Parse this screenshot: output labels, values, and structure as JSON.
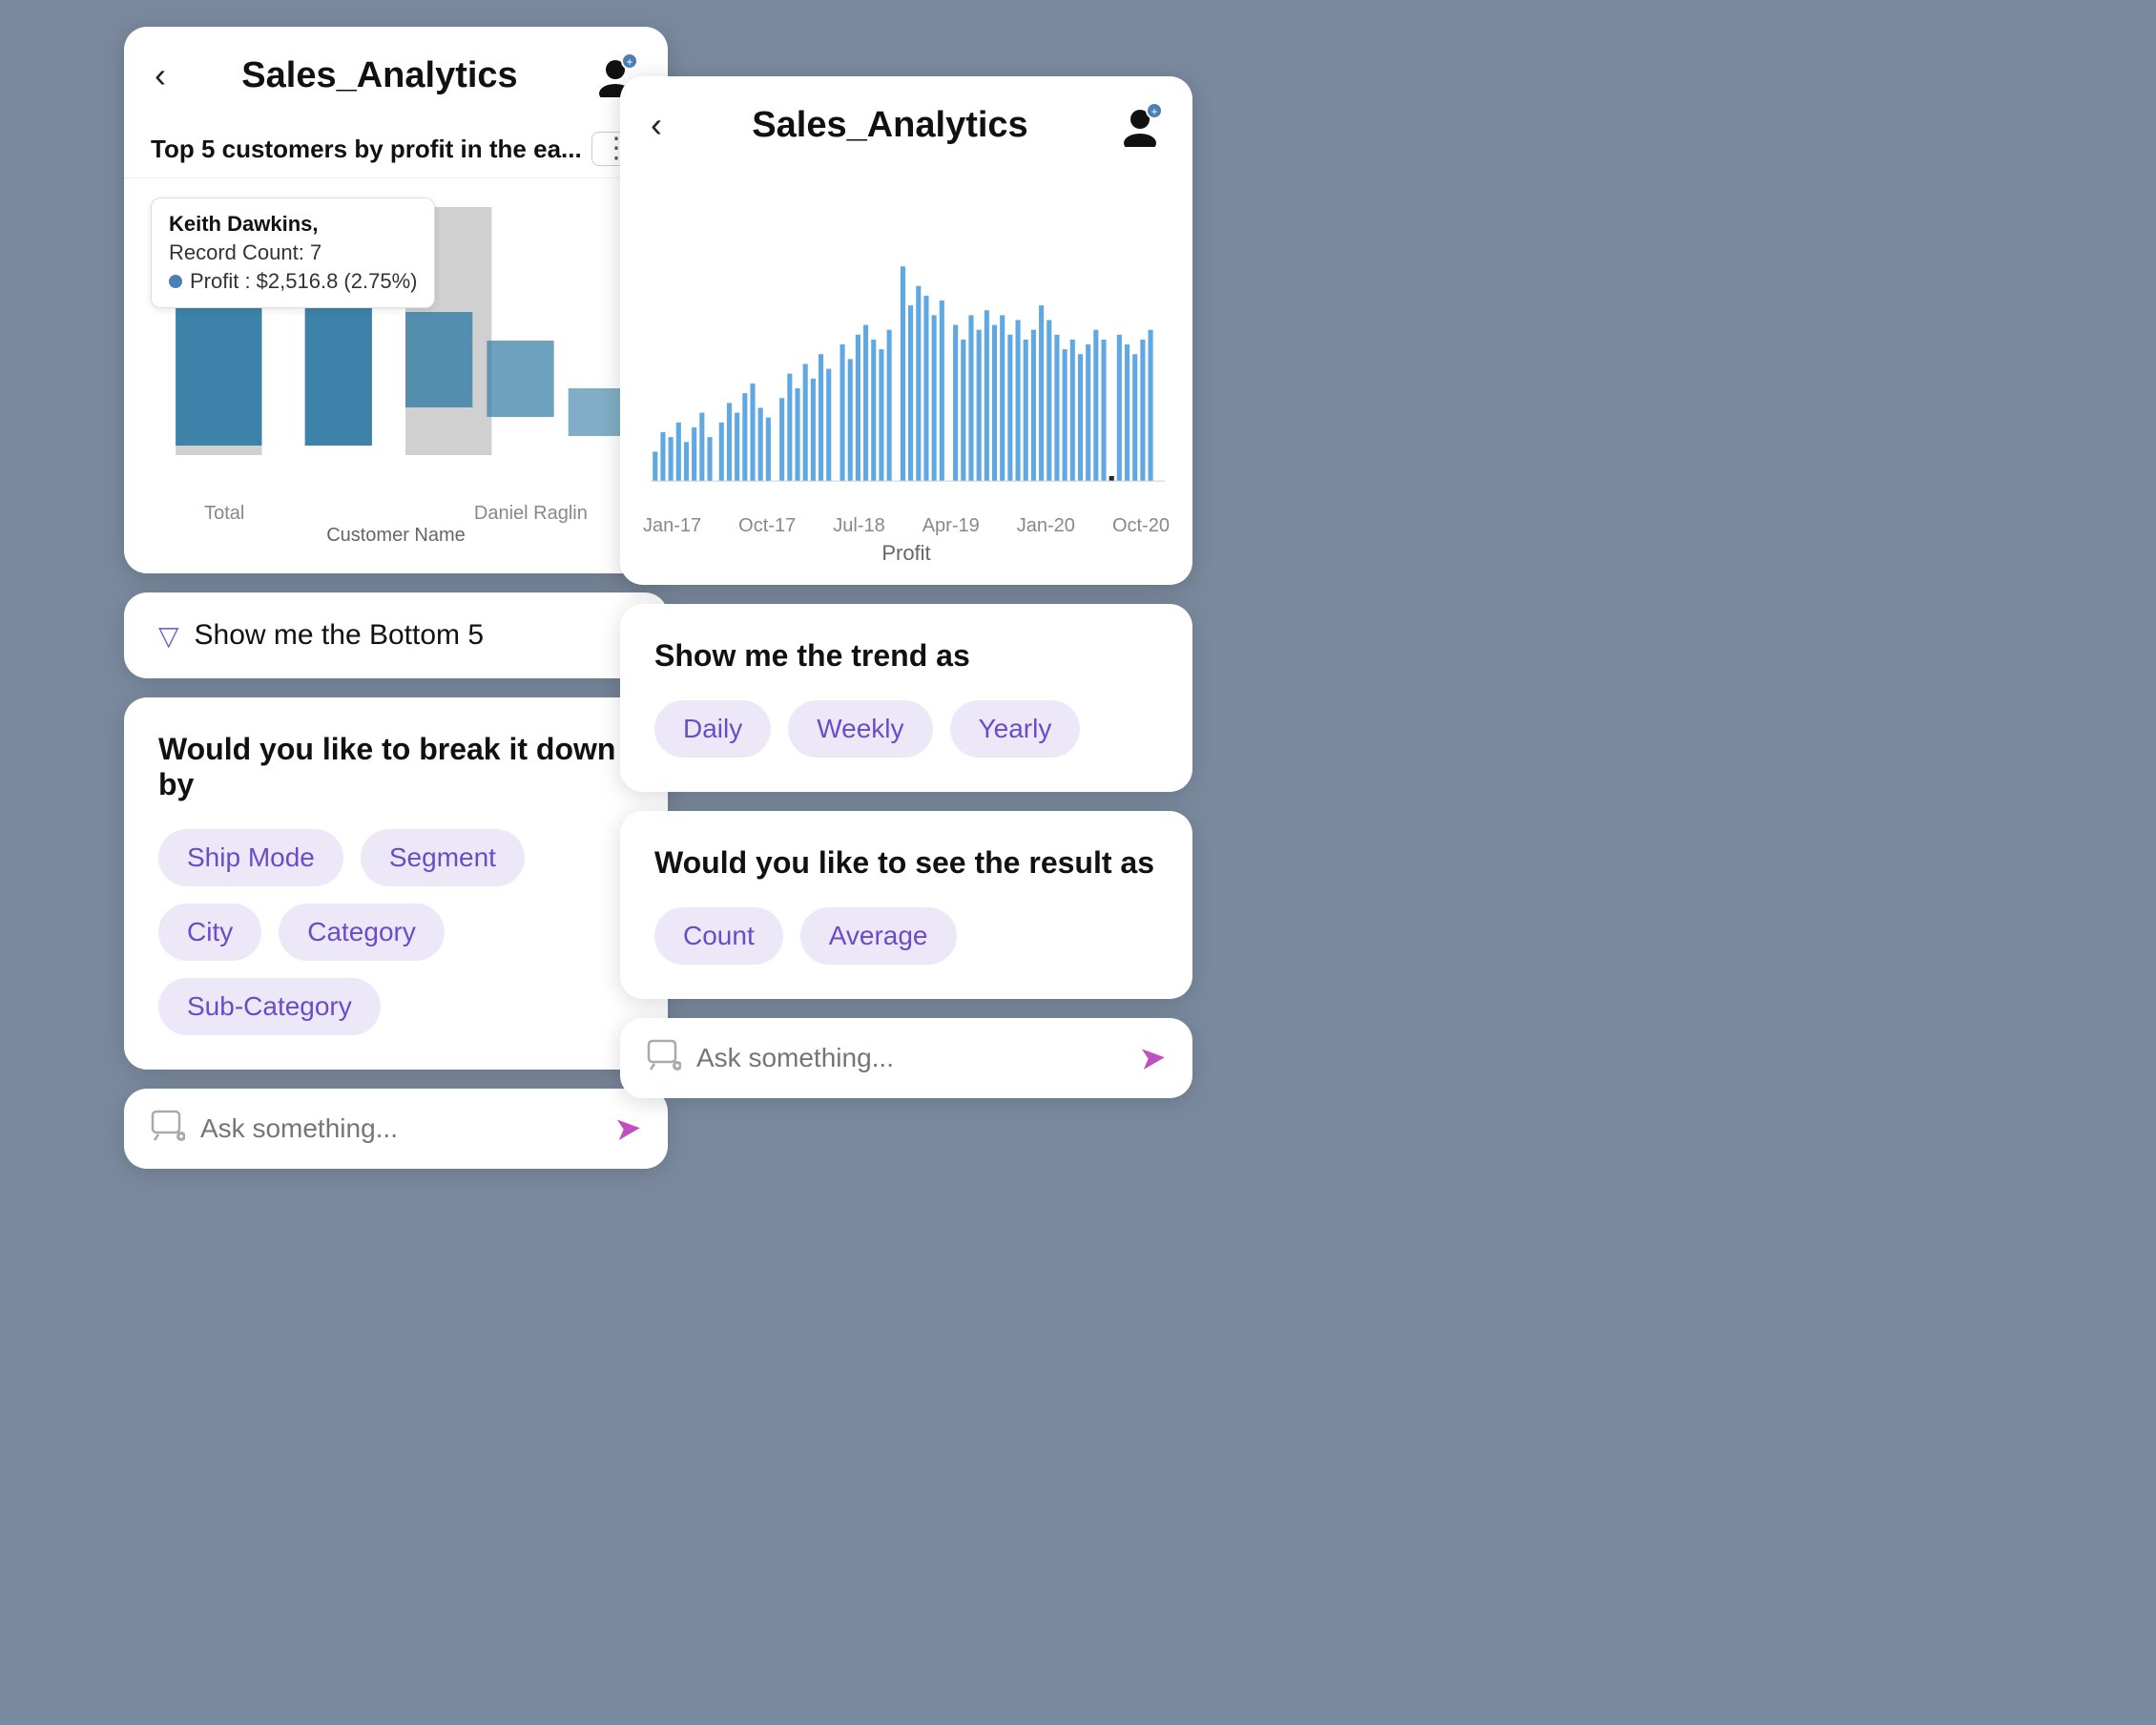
{
  "left": {
    "header": {
      "back_label": "‹",
      "title": "Sales_Analytics"
    },
    "chart": {
      "title": "Top 5 customers by profit in the ea...",
      "more_icon": "⋮",
      "tooltip": {
        "name": "Keith Dawkins,",
        "count_label": "Record Count: 7",
        "profit_label": "Profit : $2,516.8 (2.75%)"
      },
      "x_labels": [
        "Total",
        "",
        "Daniel Raglin"
      ],
      "x_axis_title": "Customer Name"
    },
    "suggestion": {
      "icon": "▽",
      "text": "Show me the Bottom 5"
    },
    "breakdown": {
      "title": "Would you like to break it down by",
      "chips": [
        "Ship Mode",
        "Segment",
        "City",
        "Category",
        "Sub-Category"
      ]
    },
    "chat_input": {
      "placeholder": "Ask something...",
      "send_icon": "➤"
    }
  },
  "right": {
    "header": {
      "back_label": "‹",
      "title": "Sales_Analytics"
    },
    "chart": {
      "x_labels": [
        "Jan-17",
        "Oct-17",
        "Jul-18",
        "Apr-19",
        "Jan-20",
        "Oct-20"
      ],
      "y_label": "Profit"
    },
    "trend": {
      "title": "Show me the trend as",
      "chips": [
        "Daily",
        "Weekly",
        "Yearly"
      ]
    },
    "result": {
      "title": "Would you like to see the result as",
      "chips": [
        "Count",
        "Average"
      ]
    },
    "chat_input": {
      "placeholder": "Ask something...",
      "send_icon": "➤"
    }
  }
}
